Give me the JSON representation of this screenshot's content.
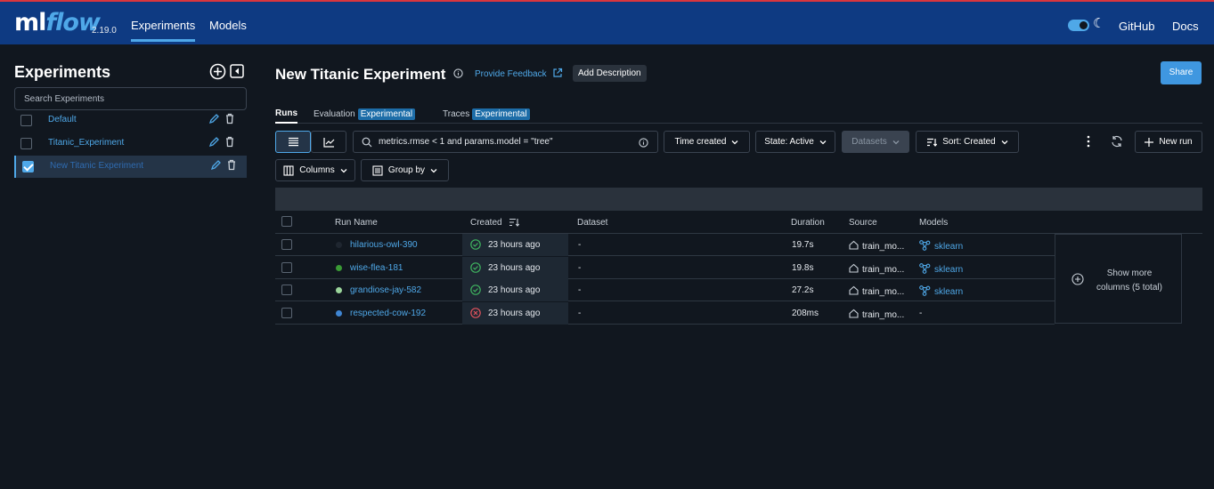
{
  "app": {
    "logo_ml": "ml",
    "logo_flow": "flow",
    "version": "2.19.0",
    "nav": [
      {
        "label": "Experiments"
      },
      {
        "label": "Models"
      }
    ],
    "github": "GitHub",
    "docs": "Docs"
  },
  "sidebar": {
    "title": "Experiments",
    "search_placeholder": "Search Experiments",
    "items": [
      {
        "name": "Default",
        "selected": false
      },
      {
        "name": "Titanic_Experiment",
        "selected": false
      },
      {
        "name": "New Titanic Experiment",
        "selected": true
      }
    ]
  },
  "header": {
    "title": "New Titanic Experiment",
    "feedback": "Provide Feedback",
    "add_description": "Add Description",
    "share": "Share"
  },
  "tabs": [
    {
      "label": "Runs",
      "badge": ""
    },
    {
      "label": "Evaluation",
      "badge": "Experimental"
    },
    {
      "label": "Traces",
      "badge": "Experimental"
    }
  ],
  "toolbar": {
    "filter": "metrics.rmse < 1 and params.model = \"tree\"",
    "time_created": "Time created",
    "state": "State: Active",
    "datasets": "Datasets",
    "sort": "Sort: Created",
    "new_run": "New run",
    "columns": "Columns",
    "group_by": "Group by"
  },
  "table": {
    "headers": [
      "Run Name",
      "Created",
      "Dataset",
      "Duration",
      "Source",
      "Models"
    ],
    "rows": [
      {
        "name": "hilarious-owl-390",
        "dot": "#1f2630",
        "status": "ok",
        "created": "23 hours ago",
        "dataset": "-",
        "duration": "19.7s",
        "source": "train_mo...",
        "model": "sklearn"
      },
      {
        "name": "wise-flea-181",
        "dot": "#3a9a35",
        "status": "ok",
        "created": "23 hours ago",
        "dataset": "-",
        "duration": "19.8s",
        "source": "train_mo...",
        "model": "sklearn"
      },
      {
        "name": "grandiose-jay-582",
        "dot": "#9bd59b",
        "status": "ok",
        "created": "23 hours ago",
        "dataset": "-",
        "duration": "27.2s",
        "source": "train_mo...",
        "model": "sklearn"
      },
      {
        "name": "respected-cow-192",
        "dot": "#3f85d2",
        "status": "failed",
        "created": "23 hours ago",
        "dataset": "-",
        "duration": "208ms",
        "source": "train_mo...",
        "model": "-"
      }
    ],
    "show_more_1": "Show more",
    "show_more_2": "columns (5 total)"
  },
  "colors": {
    "accent": "#4fa8e8",
    "topbar": "#0e3a82",
    "success": "#3fb35f",
    "error": "#e0525c"
  }
}
